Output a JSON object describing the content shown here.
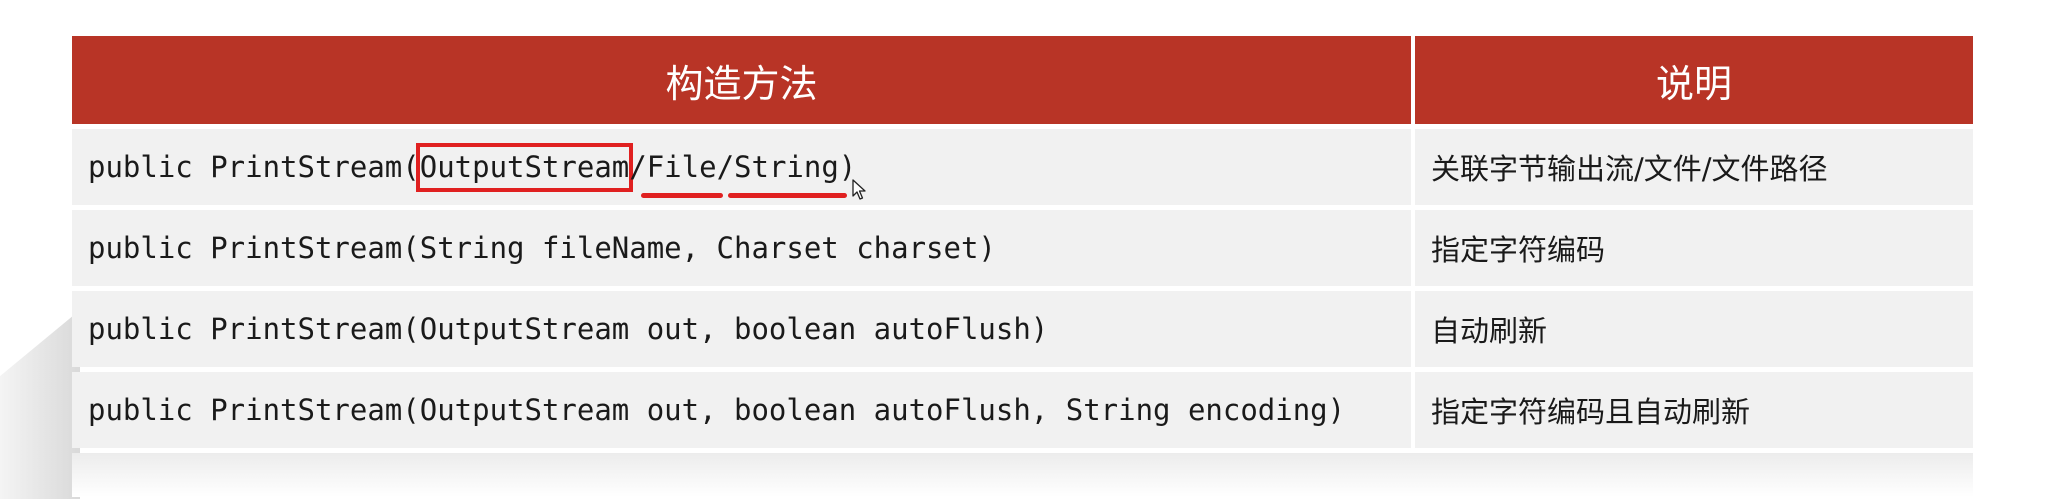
{
  "table": {
    "headers": [
      "构造方法",
      "说明"
    ],
    "rows": [
      {
        "method_parts": [
          "public PrintStream(",
          "OutputStream",
          "/",
          "File",
          "/",
          "String",
          ")"
        ],
        "desc": "关联字节输出流/文件/文件路径"
      },
      {
        "method": "public PrintStream(String fileName, Charset charset)",
        "desc": "指定字符编码"
      },
      {
        "method": "public PrintStream(OutputStream out, boolean autoFlush)",
        "desc": "自动刷新"
      },
      {
        "method": "public PrintStream(OutputStream out, boolean autoFlush, String encoding)",
        "desc": "指定字符编码且自动刷新"
      }
    ]
  },
  "colors": {
    "header_bg": "#b83426",
    "row_bg": "#f1f1f1",
    "annotation": "#e02020"
  },
  "icons": [
    "mouse-cursor-icon"
  ]
}
